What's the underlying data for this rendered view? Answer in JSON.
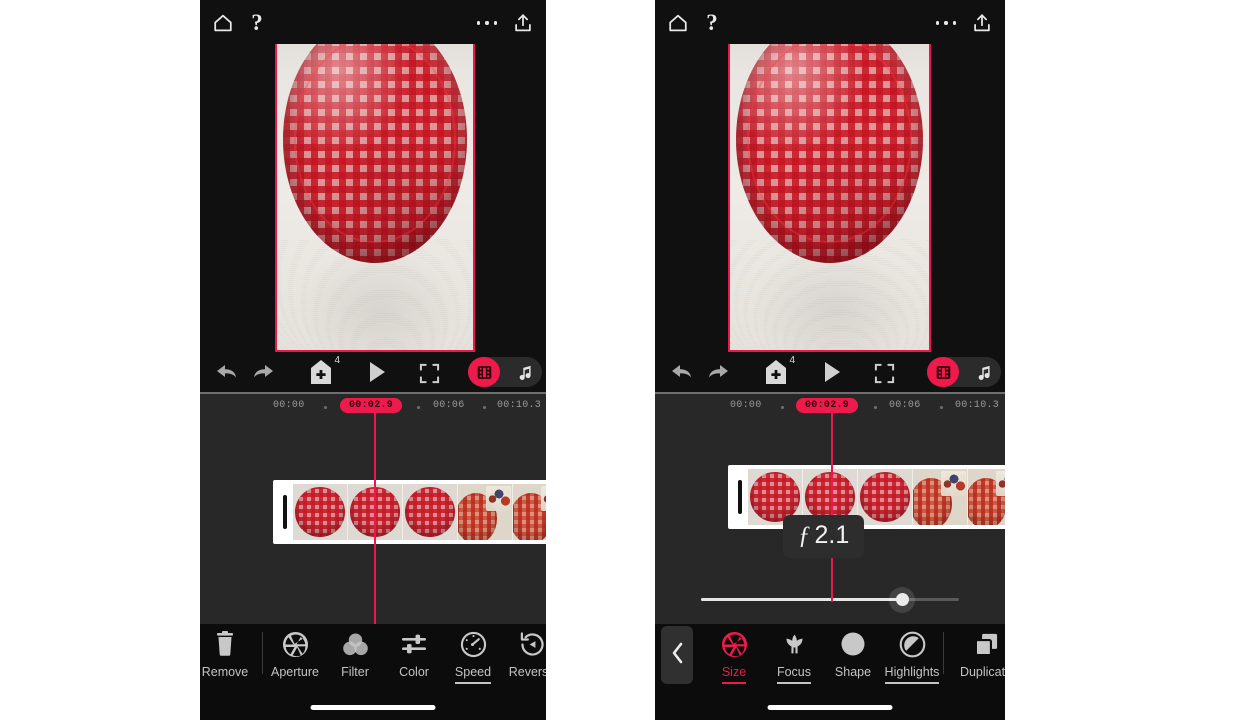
{
  "app": {
    "name": "video-editor",
    "accent": "#ef1a4c",
    "panel_bg": "#101010",
    "timeline_bg": "#282828",
    "toolbar_bg": "#0c0c0c"
  },
  "topbar": {
    "home_icon": "home-icon",
    "help_icon": "question-mark-icon",
    "more_icon": "more-vertical-icon",
    "share_icon": "share-upload-icon"
  },
  "preview": {
    "description": "red gingham paper plate on white textured counter",
    "border_color": "#e8194f"
  },
  "controls": {
    "undo_icon": "undo-arrow-icon",
    "redo_icon": "redo-arrow-icon",
    "add_icon": "add-clip-icon",
    "add_badge": "4",
    "play_icon": "play-icon",
    "fullscreen_icon": "fullscreen-icon",
    "film_icon": "film-strip-icon",
    "music_icon": "music-note-icon",
    "film_active": true
  },
  "timeline": {
    "ticks": [
      {
        "label": "00:00",
        "current": false
      },
      {
        "label": "00:02.9",
        "current": true
      },
      {
        "label": "00:06",
        "current": false
      },
      {
        "label": "00:10.3",
        "current": false
      }
    ],
    "playhead_time": "00:02.9"
  },
  "left_panel": {
    "tools": [
      {
        "name": "remove",
        "label": "Remove",
        "icon": "trash-icon",
        "active": false,
        "underline": false
      },
      {
        "name": "aperture",
        "label": "Aperture",
        "icon": "aperture-icon",
        "active": false,
        "underline": false
      },
      {
        "name": "filter",
        "label": "Filter",
        "icon": "filter-circles-icon",
        "active": false,
        "underline": false
      },
      {
        "name": "color",
        "label": "Color",
        "icon": "sliders-icon",
        "active": false,
        "underline": false
      },
      {
        "name": "speed",
        "label": "Speed",
        "icon": "speedometer-icon",
        "active": false,
        "underline": true
      },
      {
        "name": "reverse",
        "label": "Reverse",
        "icon": "reverse-icon",
        "active": false,
        "underline": false
      }
    ]
  },
  "right_panel": {
    "back_icon": "chevron-left-icon",
    "f_number": {
      "symbol": "ƒ",
      "value": "2.1"
    },
    "slider": {
      "value_percent": 78
    },
    "tools": [
      {
        "name": "size",
        "label": "Size",
        "icon": "aperture-icon",
        "active": true,
        "underline": true
      },
      {
        "name": "focus",
        "label": "Focus",
        "icon": "tulip-icon",
        "active": false,
        "underline": true
      },
      {
        "name": "shape",
        "label": "Shape",
        "icon": "circle-icon",
        "active": false,
        "underline": false
      },
      {
        "name": "highlights",
        "label": "Highlights",
        "icon": "half-circle-icon",
        "active": false,
        "underline": true
      },
      {
        "name": "duplicate",
        "label": "Duplicate",
        "icon": "duplicate-icon",
        "active": false,
        "underline": false
      }
    ]
  },
  "filmstrip": {
    "frames": [
      "frame-1",
      "frame-2",
      "frame-3",
      "frame-4",
      "frame-5"
    ],
    "handle": "trim-handle"
  }
}
